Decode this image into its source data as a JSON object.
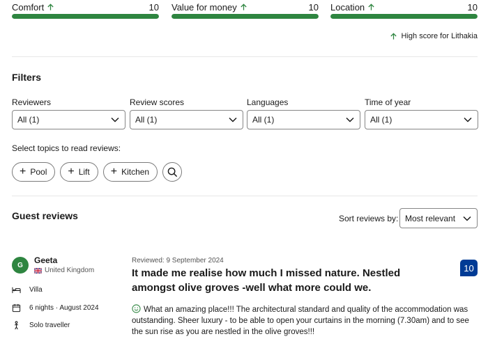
{
  "scores": [
    {
      "label": "Comfort",
      "value": "10",
      "fill_fraction": 1.0
    },
    {
      "label": "Value for money",
      "value": "10",
      "fill_fraction": 1.0
    },
    {
      "label": "Location",
      "value": "10",
      "fill_fraction": 1.0
    }
  ],
  "high_score_text": "High score for Lithakia",
  "filters": {
    "title": "Filters",
    "items": [
      {
        "label": "Reviewers",
        "value": "All (1)"
      },
      {
        "label": "Review scores",
        "value": "All (1)"
      },
      {
        "label": "Languages",
        "value": "All (1)"
      },
      {
        "label": "Time of year",
        "value": "All (1)"
      }
    ]
  },
  "topics": {
    "label": "Select topics to read reviews:",
    "chips": [
      "Pool",
      "Lift",
      "Kitchen"
    ]
  },
  "guest_reviews": {
    "title": "Guest reviews",
    "sort_label": "Sort reviews by:",
    "sort_value": "Most relevant"
  },
  "review": {
    "avatar_initial": "G",
    "name": "Geeta",
    "country": "United Kingdom",
    "room": "Villa",
    "stay": "6 nights · August 2024",
    "traveller_type": "Solo traveller",
    "reviewed_date": "Reviewed: 9 September 2024",
    "title": "It made me realise how much I missed nature. Nestled amongst olive groves -well what more could we.",
    "score": "10",
    "body": "What an amazing place!!! The architectural standard and quality of the accommodation was outstanding. Sheer luxury - to be able to open your curtains in the morning (7.30am) and to see the sun rise as you are nestled in the olive groves!!!"
  },
  "colors": {
    "accent_green": "#2e8540",
    "score_badge_blue": "#003b95"
  }
}
